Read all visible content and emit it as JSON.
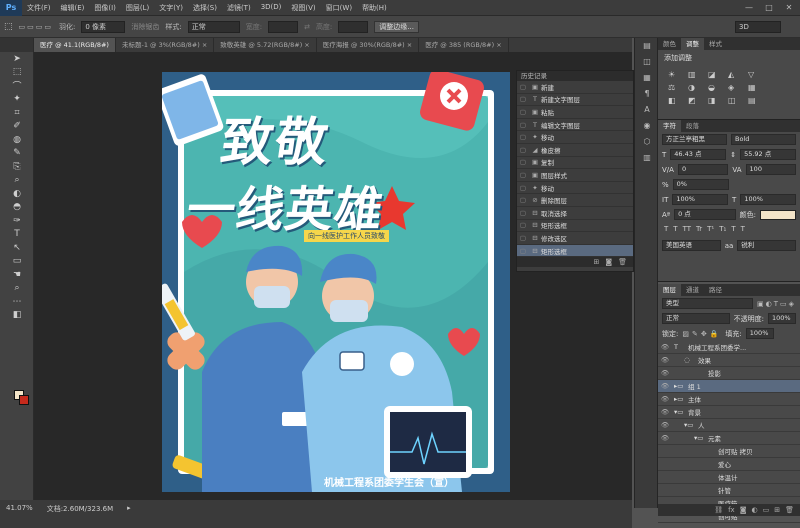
{
  "app": {
    "logo": "Ps"
  },
  "menu": [
    "文件(F)",
    "编辑(E)",
    "图像(I)",
    "图层(L)",
    "文字(Y)",
    "选择(S)",
    "滤镜(T)",
    "3D(D)",
    "视图(V)",
    "窗口(W)",
    "帮助(H)"
  ],
  "window_controls": [
    "—",
    "□",
    "✕"
  ],
  "options": {
    "feather_label": "羽化:",
    "feather_value": "0 像素",
    "antialias_label": "消除锯齿",
    "style_label": "样式:",
    "style_value": "正常",
    "width_label": "宽度:",
    "height_label": "高度:",
    "refine_button": "调整边缘...",
    "workspace": "3D"
  },
  "doc_tabs": [
    {
      "label": "医疗 @ 41.1(RGB/8#)",
      "active": true
    },
    {
      "label": "未标题-1 @ 3%(RGB/8#) ×",
      "active": false
    },
    {
      "label": "致敬英雄 @ 5.72(RGB/8#) ×",
      "active": false
    },
    {
      "label": "医疗海报 @ 30%(RGB/8#) ×",
      "active": false
    },
    {
      "label": "医疗 @ 385 (RGB/8#) ×",
      "active": false
    }
  ],
  "tools": [
    "➤",
    "⬚",
    "⌒",
    "✦",
    "⌗",
    "✐",
    "◍",
    "✎",
    "⎘",
    "⌕",
    "◐",
    "◓",
    "✑",
    "T",
    "↖",
    "▭",
    "☚",
    "⌕",
    "⋯",
    "◧"
  ],
  "poster": {
    "title_line1": "致敬",
    "title_line2": "一线英雄",
    "subtitle": "向一线医护工作人员致敬",
    "footer": "机械工程系团委学生会（宣）"
  },
  "history": {
    "title": "历史记录",
    "items": [
      {
        "icon": "▣",
        "label": "新建"
      },
      {
        "icon": "T",
        "label": "新建文字图层"
      },
      {
        "icon": "▣",
        "label": "粘贴"
      },
      {
        "icon": "T",
        "label": "编辑文字图层"
      },
      {
        "icon": "✦",
        "label": "移动"
      },
      {
        "icon": "◢",
        "label": "橡皮擦"
      },
      {
        "icon": "▣",
        "label": "复制"
      },
      {
        "icon": "▣",
        "label": "图层样式"
      },
      {
        "icon": "✦",
        "label": "移动"
      },
      {
        "icon": "⊘",
        "label": "删除图层"
      },
      {
        "icon": "⊟",
        "label": "取消选择"
      },
      {
        "icon": "⊟",
        "label": "矩形选框"
      },
      {
        "icon": "⊟",
        "label": "修改选区"
      },
      {
        "icon": "⊟",
        "label": "矩形选框",
        "selected": true
      }
    ],
    "footer_icons": [
      "⊞",
      "◙",
      "🗑"
    ]
  },
  "dock_icons": [
    "▤",
    "◫",
    "▦",
    "¶",
    "A",
    "◉",
    "⬡",
    "▥"
  ],
  "adjustments": {
    "tabs": [
      "颜色",
      "调整",
      "样式"
    ],
    "heading": "添加调整",
    "icons": [
      "☀",
      "▥",
      "◪",
      "◭",
      "▽",
      "⚖",
      "◑",
      "◒",
      "◈",
      "▦",
      "◧",
      "◩",
      "◨",
      "◫",
      "▤"
    ]
  },
  "character": {
    "tabs": [
      "字符",
      "段落"
    ],
    "font_family": "方正兰亭粗黑",
    "font_style": "Bold",
    "size": "46.43 点",
    "leading": "55.92 点",
    "tracking": "0",
    "kerning": "100",
    "scale_pct": "0%",
    "vscale": "100%",
    "hscale": "100%",
    "baseline": "0 点",
    "color_label": "颜色:",
    "antialias": "锐利",
    "language": "美国英语",
    "style_buttons": [
      "T",
      "T",
      "TT",
      "Tr",
      "T¹",
      "T₁",
      "T",
      "T"
    ]
  },
  "layers": {
    "tabs": [
      "图层",
      "通道",
      "路径"
    ],
    "kind": "类型",
    "blend": "正常",
    "opacity_label": "不透明度:",
    "opacity": "100%",
    "lock_label": "锁定:",
    "fill_label": "填充:",
    "fill": "100%",
    "items": [
      {
        "icon": "T",
        "label": "机械工程系团委学...",
        "indent": 0
      },
      {
        "icon": "◌",
        "label": "效果",
        "indent": 1
      },
      {
        "icon": "",
        "label": "投影",
        "indent": 2
      },
      {
        "icon": "▸▭",
        "label": "组 1",
        "indent": 0,
        "selected": true
      },
      {
        "icon": "▸▭",
        "label": "主体",
        "indent": 0
      },
      {
        "icon": "▾▭",
        "label": "背景",
        "indent": 0
      },
      {
        "icon": "▾▭",
        "label": "人",
        "indent": 1
      },
      {
        "icon": "▾▭",
        "label": "元素",
        "indent": 2
      },
      {
        "icon": "",
        "label": "创可贴 拷贝",
        "indent": 3
      },
      {
        "icon": "",
        "label": "爱心",
        "indent": 3
      },
      {
        "icon": "",
        "label": "体温计",
        "indent": 3
      },
      {
        "icon": "",
        "label": "针管",
        "indent": 3
      },
      {
        "icon": "",
        "label": "医疗箱",
        "indent": 3
      },
      {
        "icon": "",
        "label": "创可贴",
        "indent": 3
      }
    ],
    "footer_icons": [
      "⛓",
      "fx",
      "◙",
      "◐",
      "▭",
      "⊞",
      "🗑"
    ]
  },
  "status": {
    "zoom": "41.07%",
    "doc": "文档:2.60M/323.6M"
  }
}
